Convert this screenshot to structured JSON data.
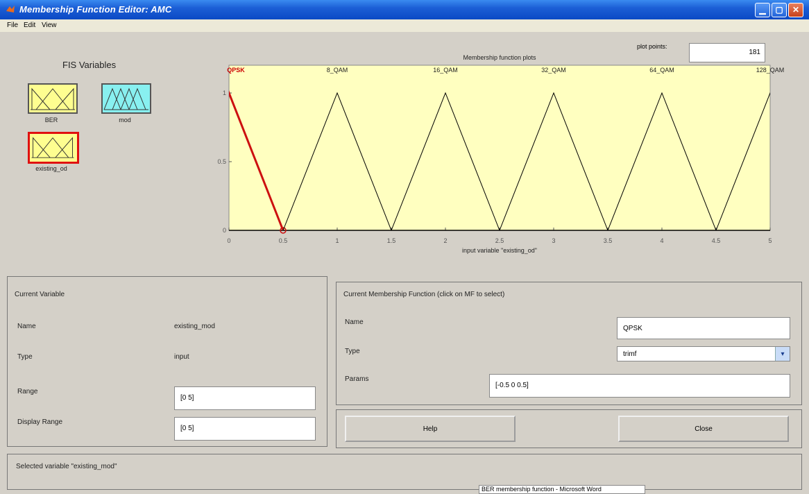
{
  "window": {
    "title": "Membership Function Editor: AMC"
  },
  "menu": [
    "File",
    "Edit",
    "View"
  ],
  "fis": {
    "heading": "FIS Variables",
    "variables": [
      {
        "name": "BER",
        "color": "#fefe90",
        "selected": false
      },
      {
        "name": "mod",
        "color": "#88f0f0",
        "selected": false
      },
      {
        "name": "existing_od",
        "color": "#fefe90",
        "selected": true
      }
    ]
  },
  "plot_points": {
    "label": "plot points:",
    "value": "181"
  },
  "chart_data": {
    "type": "line",
    "title": "Membership function plots",
    "xlabel": "input variable \"existing_od\"",
    "xlim": [
      0,
      5
    ],
    "ylim": [
      0,
      1
    ],
    "xticks": [
      "0",
      "0.5",
      "1",
      "1.5",
      "2",
      "2.5",
      "3",
      "3.5",
      "4",
      "4.5",
      "5"
    ],
    "yticks": [
      "0",
      "0.5",
      "1"
    ],
    "background": "#ffffc0",
    "series": [
      {
        "name": "QPSK",
        "x": [
          -0.5,
          0,
          0.5
        ],
        "y": [
          0,
          1,
          0
        ],
        "color": "#cc1010",
        "selected": true
      },
      {
        "name": "8_QAM",
        "x": [
          0.5,
          1,
          1.5
        ],
        "y": [
          0,
          1,
          0
        ],
        "color": "#000000"
      },
      {
        "name": "16_QAM",
        "x": [
          1.5,
          2,
          2.5
        ],
        "y": [
          0,
          1,
          0
        ],
        "color": "#000000"
      },
      {
        "name": "32_QAM",
        "x": [
          2.5,
          3,
          3.5
        ],
        "y": [
          0,
          1,
          0
        ],
        "color": "#000000"
      },
      {
        "name": "64_QAM",
        "x": [
          3.5,
          4,
          4.5
        ],
        "y": [
          0,
          1,
          0
        ],
        "color": "#000000"
      },
      {
        "name": "128_QAM",
        "x": [
          4.5,
          5,
          5.5
        ],
        "y": [
          0,
          1,
          0
        ],
        "color": "#000000"
      }
    ],
    "labels_shown": [
      "QPSK",
      "8_QAM",
      "16_QAM",
      "32_QAM",
      "64_QAM",
      "128_QAM"
    ]
  },
  "current_variable": {
    "heading": "Current Variable",
    "name_label": "Name",
    "name_value": "existing_mod",
    "type_label": "Type",
    "type_value": "input",
    "range_label": "Range",
    "range_value": "[0 5]",
    "display_range_label": "Display Range",
    "display_range_value": "[0 5]"
  },
  "current_mf": {
    "heading": "Current Membership Function (click on MF to select)",
    "name_label": "Name",
    "name_value": "QPSK",
    "type_label": "Type",
    "type_value": "trimf",
    "params_label": "Params",
    "params_value": "[-0.5 0 0.5]"
  },
  "buttons": {
    "help": "Help",
    "close": "Close"
  },
  "status": "Selected variable \"existing_mod\"",
  "taskbar_tip": "BER membership function - Microsoft Word"
}
